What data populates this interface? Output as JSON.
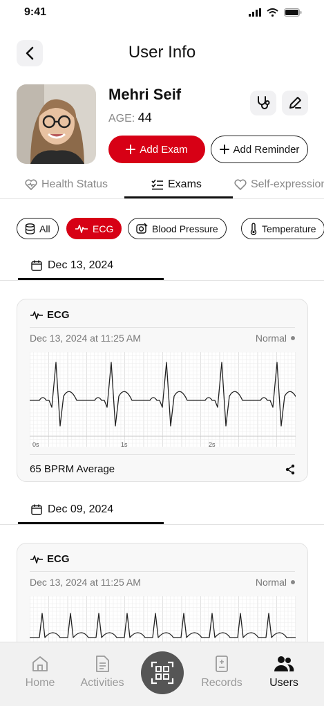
{
  "status_bar": {
    "time": "9:41"
  },
  "header": {
    "title": "User Info",
    "back_icon": "chevron-left-icon"
  },
  "user": {
    "name": "Mehri Seif",
    "age_label": "AGE:",
    "age_value": "44",
    "add_exam_label": "Add Exam",
    "add_reminder_label": "Add Reminder"
  },
  "tabs": [
    {
      "label": "Health Status",
      "icon": "heart-pulse-icon",
      "active": false
    },
    {
      "label": "Exams",
      "icon": "checklist-icon",
      "active": true
    },
    {
      "label": "Self-expression",
      "icon": "heart-icon",
      "active": false
    }
  ],
  "filters": [
    {
      "label": "All",
      "icon": "database-icon",
      "active": false
    },
    {
      "label": "ECG",
      "icon": "pulse-icon",
      "active": true
    },
    {
      "label": "Blood Pressure",
      "icon": "blood-pressure-icon",
      "active": false
    },
    {
      "label": "Temperature",
      "icon": "thermometer-icon",
      "active": false
    }
  ],
  "sections": [
    {
      "date": "Dec 13, 2024",
      "card": {
        "title": "ECG",
        "timestamp": "Dec 13, 2024 at 11:25 AM",
        "status": "Normal",
        "average": "65 BPRM Average",
        "ticks": [
          "0s",
          "1s",
          "2s"
        ]
      }
    },
    {
      "date": "Dec 09, 2024",
      "card": {
        "title": "ECG",
        "timestamp": "Dec 13, 2024 at 11:25 AM",
        "status": "Normal"
      }
    }
  ],
  "bottom_nav": [
    {
      "label": "Home",
      "icon": "home-icon",
      "active": false
    },
    {
      "label": "Activities",
      "icon": "document-icon",
      "active": false
    },
    {
      "label": "Records",
      "icon": "records-icon",
      "active": false
    },
    {
      "label": "Users",
      "icon": "users-icon",
      "active": true
    }
  ],
  "colors": {
    "accent": "#d70015",
    "text": "#111111",
    "muted": "#8a8a8a",
    "card_bg": "#f8f8f8"
  }
}
